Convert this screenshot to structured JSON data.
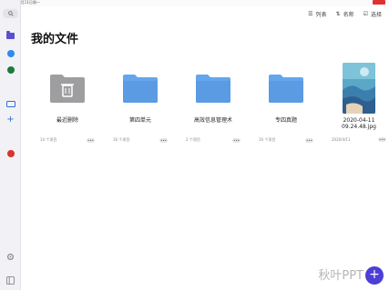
{
  "status": {
    "time": "下午3:24  5月11日周一"
  },
  "toolbar": {
    "list_label": "列表",
    "sort_label": "名称",
    "select_label": "选择"
  },
  "page_title": "我的文件",
  "items": [
    {
      "name": "最近删除",
      "meta": "14 个项目",
      "kind": "trash"
    },
    {
      "name": "第四单元",
      "meta": "16 个项目",
      "kind": "folder"
    },
    {
      "name": "高效信息管理术",
      "meta": "2 个项目",
      "kind": "folder"
    },
    {
      "name": "专四真题",
      "meta": "10 个项目",
      "kind": "folder"
    },
    {
      "name": "2020-04-11\n09.24.48.jpg",
      "meta": "2020/4/11",
      "kind": "image"
    }
  ],
  "more_label": "•••",
  "fab_label": "+",
  "watermark": "秋叶PPT",
  "colors": {
    "accent": "#4c3fd6",
    "folder": "#64a6ec",
    "trash": "#9e9ea0"
  }
}
